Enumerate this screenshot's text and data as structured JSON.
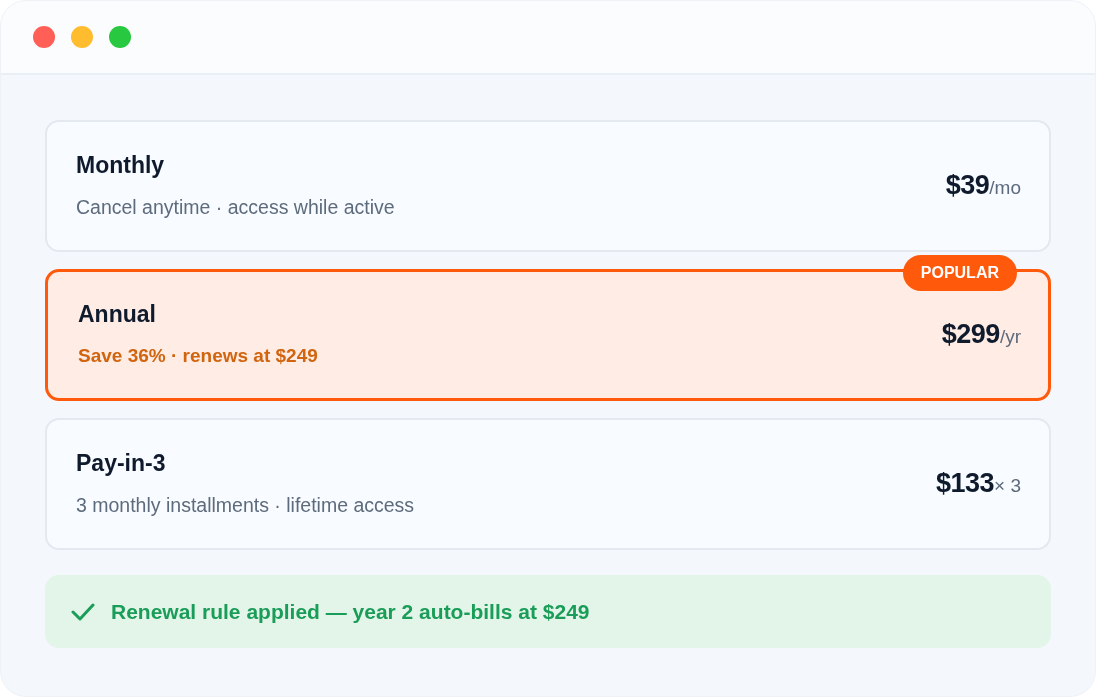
{
  "plans": [
    {
      "name": "Monthly",
      "detail": "Cancel anytime · access while active",
      "price": "$39",
      "unit": "/mo",
      "selected": false
    },
    {
      "name": "Annual",
      "detail": "Save 36% · renews at $249",
      "price": "$299",
      "unit": "/yr",
      "selected": true,
      "badge": "POPULAR"
    },
    {
      "name": "Pay-in-3",
      "detail": "3 monthly installments · lifetime access",
      "price": "$133",
      "unit": "× 3",
      "selected": false
    }
  ],
  "notice": {
    "text": "Renewal rule applied — year 2 auto-bills at $249"
  }
}
